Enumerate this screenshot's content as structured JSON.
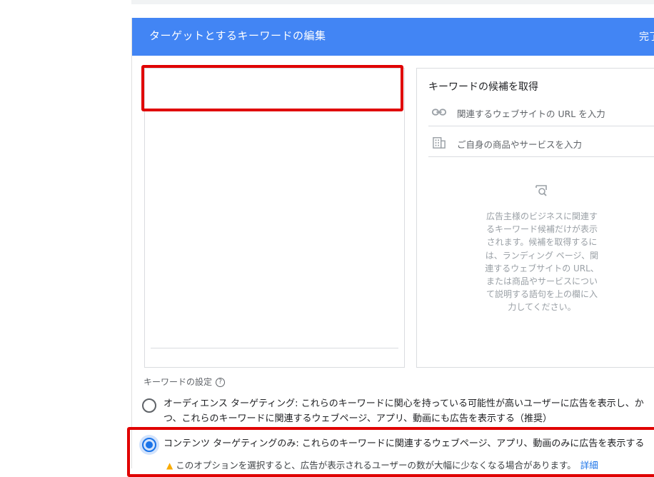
{
  "dialog": {
    "title": "ターゲットとするキーワードの編集",
    "done_label": "完了"
  },
  "keyword_input": {
    "value": "",
    "placeholder": ""
  },
  "suggestions": {
    "title": "キーワードの候補を取得",
    "url_placeholder": "関連するウェブサイトの URL を入力",
    "url_icon": "link-icon",
    "product_placeholder": "ご自身の商品やサービスを入力",
    "product_icon": "building-icon",
    "empty_icon": "search-page-icon",
    "empty_text": "広告主様のビジネスに関連するキーワード候補だけが表示されます。候補を取得するには、ランディング ページ、関連するウェブサイトの URL、または商品やサービスについて説明する語句を上の欄に入力してください。"
  },
  "settings": {
    "label": "キーワードの設定",
    "help_icon": "help-icon",
    "audience_option": "オーディエンス ターゲティング: これらのキーワードに関心を持っている可能性が高いユーザーに広告を表示し、かつ、これらのキーワードに関連するウェブページ、アプリ、動画にも広告を表示する（推奨）",
    "audience_selected": false,
    "content_option": "コンテンツ ターゲティングのみ: これらのキーワードに関連するウェブページ、アプリ、動画のみに広告を表示する",
    "content_selected": true,
    "warning": "このオプションを選択すると、広告が表示されるユーザーの数が大幅に少なくなる場合があります。",
    "warning_icon": "warning-icon",
    "details_link": "詳細"
  },
  "colors": {
    "header": "#4285f4",
    "accent": "#1a73e8",
    "highlight": "#e00000",
    "warning": "#f9ab00"
  }
}
